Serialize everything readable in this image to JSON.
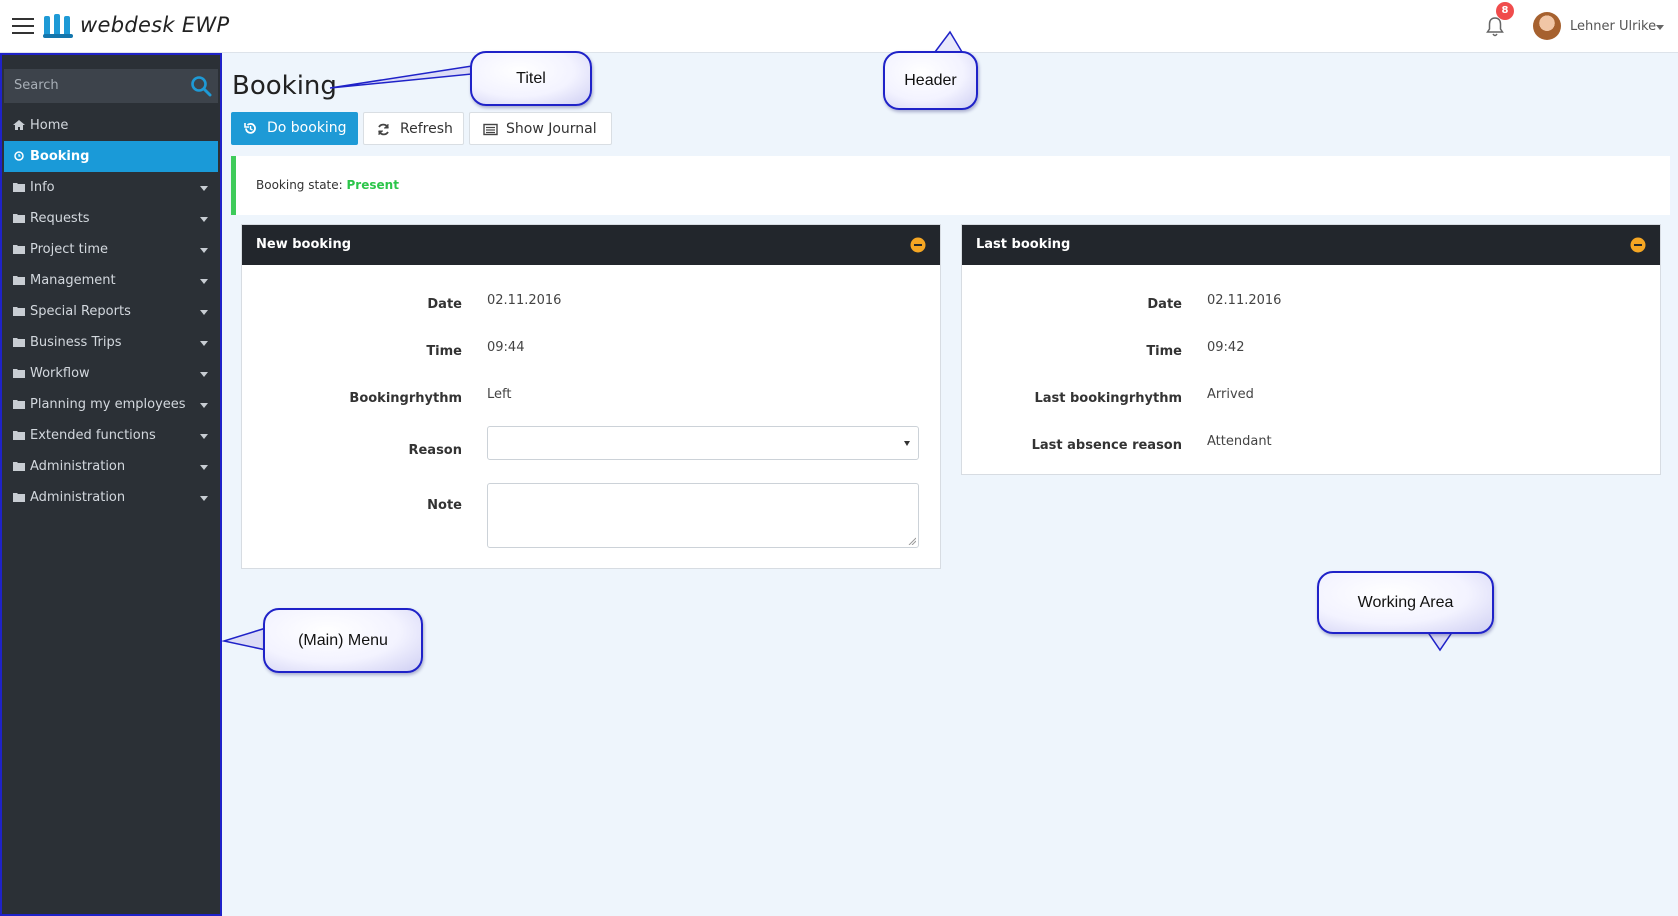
{
  "header": {
    "app_name": "webdesk EWP",
    "notifications_count": "8",
    "user_name": "Lehner Ulrike"
  },
  "sidebar": {
    "search_placeholder": "Search",
    "items": [
      {
        "label": "Home",
        "icon": "home-icon"
      },
      {
        "label": "Booking",
        "icon": "clock-icon",
        "active": true
      },
      {
        "label": "Info",
        "icon": "folder-icon"
      },
      {
        "label": "Requests",
        "icon": "folder-icon"
      },
      {
        "label": "Project time",
        "icon": "folder-icon"
      },
      {
        "label": "Management",
        "icon": "folder-icon"
      },
      {
        "label": "Special Reports",
        "icon": "folder-icon"
      },
      {
        "label": "Business Trips",
        "icon": "folder-icon"
      },
      {
        "label": "Workflow",
        "icon": "folder-icon"
      },
      {
        "label": "Planning my employees",
        "icon": "folder-icon"
      },
      {
        "label": "Extended functions",
        "icon": "folder-icon"
      },
      {
        "label": "Administration",
        "icon": "folder-icon"
      },
      {
        "label": "Administration",
        "icon": "folder-icon"
      }
    ]
  },
  "main": {
    "title": "Booking",
    "buttons": {
      "do_booking": "Do booking",
      "refresh": "Refresh",
      "show_journal": "Show Journal"
    },
    "booking_state": {
      "label": "Booking state:",
      "value": "Present"
    },
    "new_booking": {
      "title": "New booking",
      "date_label": "Date",
      "date_value": "02.11.2016",
      "time_label": "Time",
      "time_value": "09:44",
      "rhythm_label": "Bookingrhythm",
      "rhythm_value": "Left",
      "reason_label": "Reason",
      "reason_value": "",
      "note_label": "Note"
    },
    "last_booking": {
      "title": "Last booking",
      "date_label": "Date",
      "date_value": "02.11.2016",
      "time_label": "Time",
      "time_value": "09:42",
      "rhythm_label": "Last bookingrhythm",
      "rhythm_value": "Arrived",
      "absence_label": "Last absence reason",
      "absence_value": "Attendant"
    }
  },
  "callouts": {
    "titel": "Titel",
    "header": "Header",
    "main_menu": "(Main) Menu",
    "working_area": "Working Area"
  },
  "colors": {
    "accent": "#1e9ad6",
    "present": "#2cc54a",
    "sidebar_bg": "#2b3036",
    "annotation_border": "#1f22c8"
  }
}
